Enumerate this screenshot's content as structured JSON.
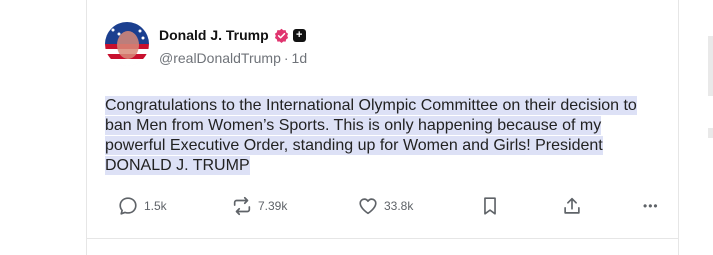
{
  "post": {
    "author_name": "Donald J. Trump",
    "handle": "@realDonaldTrump",
    "separator": "·",
    "time": "1d",
    "plus_glyph": "+",
    "text": "Congratulations to the International Olympic Committee on their decision to ban Men from Women’s Sports. This is only happening because of my powerful Executive Order, standing up for Women and Girls! President DONALD J. TRUMP"
  },
  "actions": {
    "replies": "1.5k",
    "reposts": "7.39k",
    "likes": "33.8k",
    "more_glyph": "•••"
  },
  "colors": {
    "verified_badge": "#e0356f",
    "text_highlight": "#dde1f6",
    "icon_gray": "#5f6368"
  },
  "icons": [
    "reply-icon",
    "repost-icon",
    "like-icon",
    "bookmark-icon",
    "share-icon",
    "more-icon",
    "verified-badge-icon",
    "plus-icon"
  ]
}
